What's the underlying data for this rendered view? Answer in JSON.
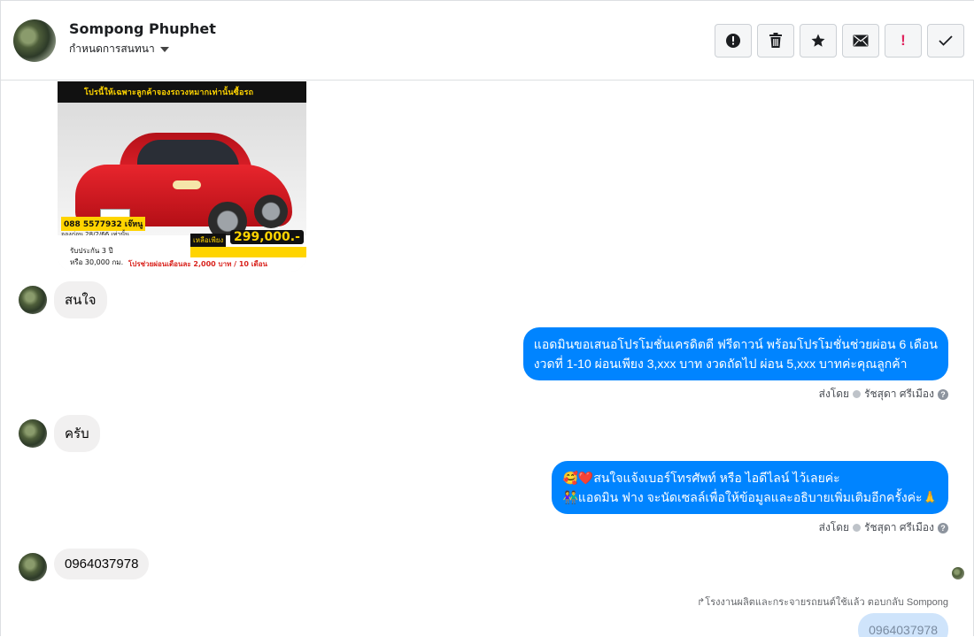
{
  "header": {
    "name": "Sompong Phuphet",
    "subtitle": "กำหนดการสนทนา",
    "actions": [
      {
        "name": "report-icon"
      },
      {
        "name": "trash-icon"
      },
      {
        "name": "star-icon"
      },
      {
        "name": "envelope-icon"
      },
      {
        "name": "spam-icon",
        "label": "!"
      },
      {
        "name": "done-checkmark-icon"
      }
    ]
  },
  "image": {
    "banner": "โปรนี้ให้เฉพาะลูกค้าจองรถวงหมากเท่านั้นซื้อรถ",
    "phone": "088 5577932 เจ๊หนู",
    "note": "จองก่อน 28/2/66 เท่านั้น",
    "price_label": "เหลือเพียง",
    "price": "299,000.-",
    "insurance1": "รับประกัน 3 ปี",
    "insurance2": "หรือ 30,000 กม.",
    "bottom": "โปรช่วยผ่อนเดือนละ 2,000 บาท / 10 เดือน"
  },
  "messages": {
    "m1": "สนใจ",
    "m2_line1": "แอดมินขอเสนอโปรโมชั่นเครดิตดี ฟรีดาวน์ พร้อมโปรโมชั่นช่วยผ่อน 6 เดือน",
    "m2_line2": "งวดที่ 1-10 ผ่อนเพียง 3,xxx บาท งวดถัดไป ผ่อน 5,xxx บาทค่ะคุณลูกค้า",
    "sent_by_label": "ส่งโดย",
    "sender": "รัชสุดา ศรีเมือง",
    "m3": "ครับ",
    "m4_line1": "🥰❤️สนใจแจ้งเบอร์โทรศัพท์ หรือ ไอดีไลน์  ไว้เลยค่ะ",
    "m4_line2": "👫แอดมิน ฟาง จะนัดเซลล์เพื่อให้ข้อมูลและอธิบายเพิ่มเติมอีกครั้งค่ะ🙏",
    "m5": "0964037978",
    "reply_note": "↱โรงงานผลิตและกระจายรถยนต์ใช้แล้ว ตอบกลับ Sompong",
    "m6": "0964037978"
  }
}
